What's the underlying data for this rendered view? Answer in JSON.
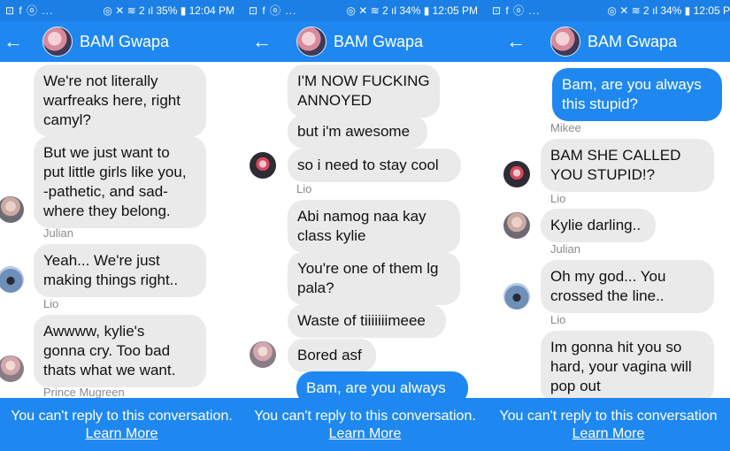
{
  "panels": [
    {
      "status": {
        "left": "⊡ f ⓞ ...",
        "right": "◎ ✕ ≋ 2 ıl 35% ▮ 12:04 PM"
      },
      "header": {
        "title": "BAM Gwapa"
      },
      "messages": [
        {
          "text": "We're not literally\nwarfreaks here, right\ncamyl?"
        },
        {
          "text": "But we just want to\nput little girls like you,\n-pathetic, and sad-\nwhere they belong."
        },
        {
          "sender": "Julian"
        },
        {
          "text": "Yeah... We're just\nmaking things right.."
        },
        {
          "sender": "Lio"
        },
        {
          "text": "Awwww, kylie's\ngonna cry. Too bad\nthats what we want."
        },
        {
          "sender": "Prince Mugreen"
        }
      ],
      "footer": {
        "notice": "You can't reply to this conversation.",
        "link": "Learn More"
      }
    },
    {
      "status": {
        "left": "⊡ f ⓞ ...",
        "right": "◎ ✕ ≋ 2 ıl 34% ▮ 12:05 PM"
      },
      "header": {
        "title": "BAM Gwapa"
      },
      "messages": [
        {
          "text": "I'M NOW FUCKING\nANNOYED"
        },
        {
          "text": "but i'm awesome"
        },
        {
          "text": "so i need to stay cool"
        },
        {
          "sender": "Lio"
        },
        {
          "text": "Abi namog naa kay\nclass kylie"
        },
        {
          "text": "You're one of them lg\npala?"
        },
        {
          "text": "Waste of tiiiiiiimeee"
        },
        {
          "text": "Bored asf"
        },
        {
          "text": "Bam, are you always"
        }
      ],
      "footer": {
        "notice": "You can't reply to this conversation.",
        "link": "Learn More"
      }
    },
    {
      "status": {
        "left": "⊡ f ⓞ ...",
        "right": "◎ ✕ ≋ 2 ıl 34% ▮ 12:05 P"
      },
      "header": {
        "title": "BAM Gwapa"
      },
      "messages": [
        {
          "text": "Bam, are you always\nthis stupid?"
        },
        {
          "sender": "Mikee"
        },
        {
          "text": "BAM SHE CALLED\nYOU STUPID!?"
        },
        {
          "sender": "Lio"
        },
        {
          "text": "Kylie darling.."
        },
        {
          "sender": "Julian"
        },
        {
          "text": "Oh my god... You\ncrossed the line.."
        },
        {
          "sender": "Lio"
        },
        {
          "text": "Im gonna hit you so\nhard, your vagina will\npop out"
        }
      ],
      "footer": {
        "notice": "You can't reply to this conversation",
        "link": "Learn More"
      }
    }
  ],
  "icons": {
    "back": "back-arrow-icon"
  },
  "colors": {
    "brand": "#1e88f0",
    "status": "#1b7fe6",
    "incoming": "#eaeaea"
  }
}
